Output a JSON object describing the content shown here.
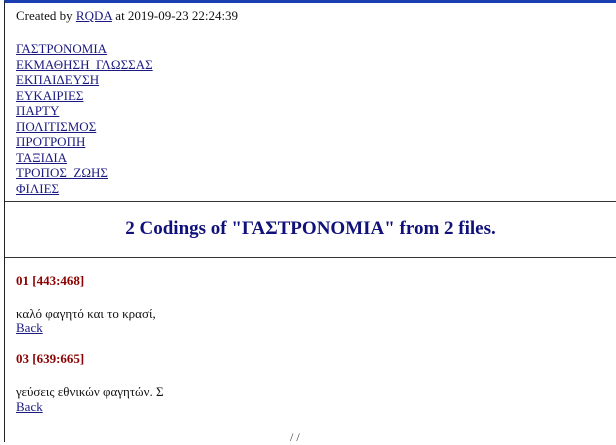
{
  "header": {
    "prefix": "Created by ",
    "tool": "RQDA",
    "suffix": " at 2019-09-23 22:24:39"
  },
  "nav": {
    "items": [
      "ΓΑΣΤΡΟΝΟΜΙΑ",
      "ΕΚΜΑΘΗΣΗ_ΓΛΩΣΣΑΣ",
      "ΕΚΠΑΙΔΕΥΣΗ",
      "ΕΥΚΑΙΡΙΕΣ",
      "ΠΑΡΤΥ",
      "ΠΟΛΙΤΙΣΜΟΣ",
      "ΠΡΟΤΡΟΠΗ",
      "ΤΑΞΙΔΙΑ",
      "ΤΡΟΠΟΣ_ΖΩΗΣ",
      "ΦΙΛΙΕΣ"
    ]
  },
  "main": {
    "heading": "2 Codings of \"ΓΑΣΤΡΟΝΟΜΙΑ\" from 2 files.",
    "codings": [
      {
        "label": "01 [443:468]",
        "text": "καλό φαγητό και το κρασί,",
        "back": "Back"
      },
      {
        "label": "03 [639:665]",
        "text": "γεύσεις εθνικών φαγητών. Σ",
        "back": "Back"
      }
    ]
  },
  "footer": {
    "fragment": "/ /"
  }
}
